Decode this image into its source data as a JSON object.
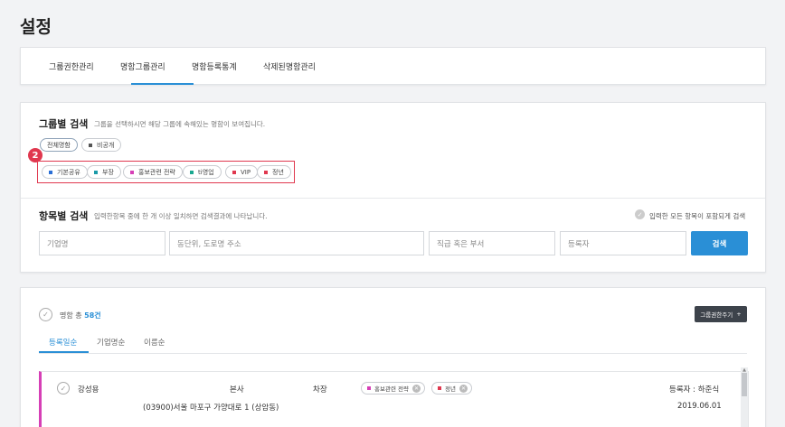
{
  "page": {
    "title": "설정"
  },
  "tabs": [
    {
      "label": "그룹권한관리"
    },
    {
      "label": "명함그룹관리"
    },
    {
      "label": "명함등록통계"
    },
    {
      "label": "삭제된명함관리"
    }
  ],
  "group_search": {
    "title": "그룹별 검색",
    "description": "그룹을 선택하시면 해당 그룹에 속해있는 명함이 보여집니다.",
    "row1": [
      {
        "label": "전체명함",
        "selected": true
      },
      {
        "label": "비공개",
        "color": "#555555"
      }
    ],
    "badge": "2",
    "row2": [
      {
        "label": "기본공유",
        "color": "#2a6fd6"
      },
      {
        "label": "부장",
        "color": "#1a9aa8"
      },
      {
        "label": "홍보관련 전략",
        "color": "#d63fb6"
      },
      {
        "label": "ti영업",
        "color": "#1aa890"
      },
      {
        "label": "VIP",
        "color": "#e0384f"
      },
      {
        "label": "정년",
        "color": "#e0384f"
      }
    ]
  },
  "field_search": {
    "title": "항목별 검색",
    "description": "입력한항목 중에 한 개 이상 일치하면 검색결과에 나타납니다.",
    "include_all_label": "입력한 모든 항목이 포함되게 검색",
    "inputs": [
      {
        "placeholder": "기업명"
      },
      {
        "placeholder": "동단위, 도로명 주소"
      },
      {
        "placeholder": "직급 혹은 부서"
      },
      {
        "placeholder": "등록자"
      }
    ],
    "search_button": "검색"
  },
  "list": {
    "count_prefix": "명함 총",
    "count_value": "58건",
    "share_button": "그룹권한주기",
    "share_button_icon": "+",
    "sort_tabs": [
      {
        "label": "등록일순",
        "active": true
      },
      {
        "label": "기업명순"
      },
      {
        "label": "이름순"
      }
    ],
    "rows": [
      {
        "name": "강성용",
        "company": "본사",
        "position": "차장",
        "tags": [
          {
            "label": "홍보관련 전략",
            "color": "#d63fb6"
          },
          {
            "label": "정년",
            "color": "#e0384f"
          }
        ],
        "registrant": "등록자 : 하준식",
        "address": "(03900)서울 마포구 가양대로 1 (상암동)",
        "date": "2019.06.01"
      }
    ]
  }
}
